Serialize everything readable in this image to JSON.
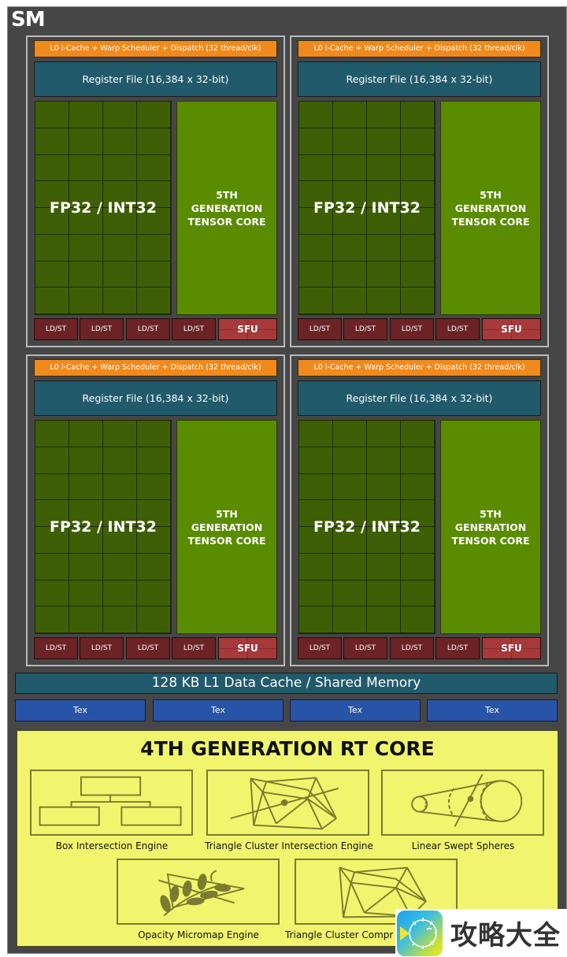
{
  "sm": {
    "title": "SM"
  },
  "partitions": [
    {
      "scheduler": "L0 i-Cache + Warp Scheduler + Dispatch (32 thread/clk)",
      "register_file": "Register File (16,384 x 32-bit)",
      "cores_label": "FP32 / INT32",
      "tensor_core": [
        "5TH",
        "GENERATION",
        "TENSOR CORE"
      ],
      "ldst_units": [
        "LD/ST",
        "LD/ST",
        "LD/ST",
        "LD/ST"
      ],
      "sfu": "SFU"
    },
    {
      "scheduler": "L0 i-Cache + Warp Scheduler + Dispatch (32 thread/clk)",
      "register_file": "Register File (16,384 x 32-bit)",
      "cores_label": "FP32 / INT32",
      "tensor_core": [
        "5TH",
        "GENERATION",
        "TENSOR CORE"
      ],
      "ldst_units": [
        "LD/ST",
        "LD/ST",
        "LD/ST",
        "LD/ST"
      ],
      "sfu": "SFU"
    },
    {
      "scheduler": "L0 i-Cache + Warp Scheduler + Dispatch (32 thread/clk)",
      "register_file": "Register File (16,384 x 32-bit)",
      "cores_label": "FP32 / INT32",
      "tensor_core": [
        "5TH",
        "GENERATION",
        "TENSOR CORE"
      ],
      "ldst_units": [
        "LD/ST",
        "LD/ST",
        "LD/ST",
        "LD/ST"
      ],
      "sfu": "SFU"
    },
    {
      "scheduler": "L0 i-Cache + Warp Scheduler + Dispatch (32 thread/clk)",
      "register_file": "Register File (16,384 x 32-bit)",
      "cores_label": "FP32 / INT32",
      "tensor_core": [
        "5TH",
        "GENERATION",
        "TENSOR CORE"
      ],
      "ldst_units": [
        "LD/ST",
        "LD/ST",
        "LD/ST",
        "LD/ST"
      ],
      "sfu": "SFU"
    }
  ],
  "l1_cache": "128 KB L1 Data Cache / Shared Memory",
  "tex_units": [
    "Tex",
    "Tex",
    "Tex",
    "Tex"
  ],
  "rt_core": {
    "title": "4TH GENERATION RT CORE",
    "engines": [
      {
        "label": "Box Intersection Engine",
        "icon": "box-hierarchy-icon"
      },
      {
        "label": "Triangle Cluster Intersection Engine",
        "icon": "triangle-mesh-ray-icon"
      },
      {
        "label": "Linear Swept Spheres",
        "icon": "swept-spheres-icon"
      },
      {
        "label": "Opacity Micromap Engine",
        "icon": "leaf-micromap-icon"
      },
      {
        "label": "Triangle Cluster Compr",
        "icon": "triangle-mesh-icon"
      }
    ]
  },
  "watermark": {
    "text": "攻略大全",
    "icon": "pufferfish-logo-icon"
  },
  "colors": {
    "sm_background": "#464646",
    "scheduler": "#f08a1c",
    "register_file": "#215a6b",
    "fp32": "#3f5f06",
    "tensor_core": "#5a8c00",
    "ldst": "#6b2325",
    "sfu": "#a6393a",
    "tex": "#2754a6",
    "rt_core": "#f1f56d",
    "rt_icon": "#7a7a30"
  }
}
